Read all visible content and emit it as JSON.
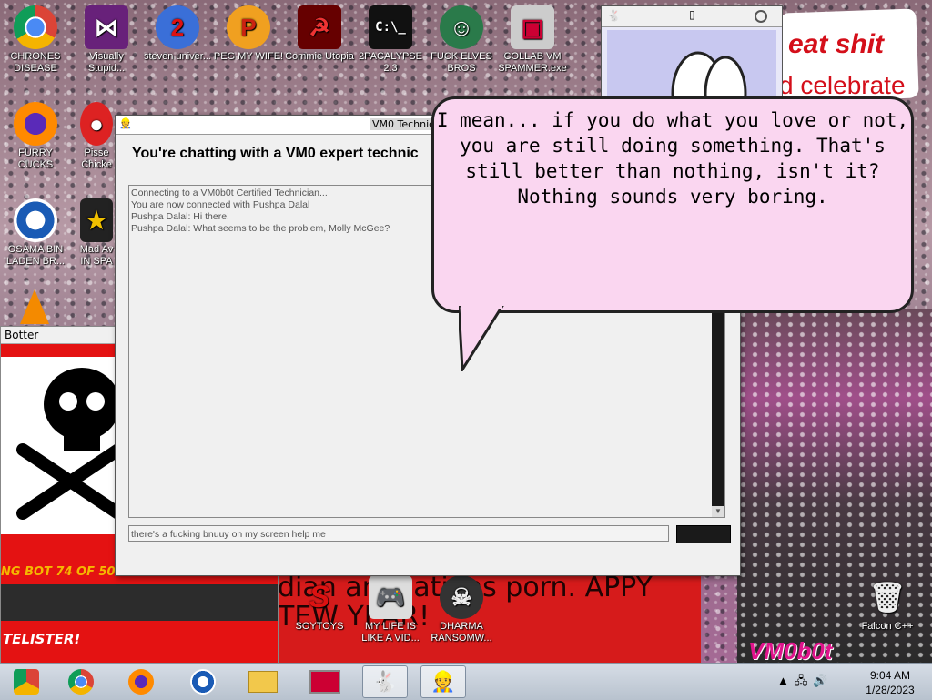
{
  "desktop": {
    "icons": [
      {
        "label": "CHRONES DISEASE",
        "icon": "chrome-icon"
      },
      {
        "label": "Visually Stupid...",
        "icon": "visual-studio-icon"
      },
      {
        "label": "steven univer...",
        "icon": "number-2-icon"
      },
      {
        "label": "PEG MY WIFE!",
        "icon": "p-icon"
      },
      {
        "label": "Commie Utopia",
        "icon": "hammer-sickle-icon"
      },
      {
        "label": "2PACALYPSE 2.3",
        "icon": "console-icon"
      },
      {
        "label": "FUCK ELVES BROS",
        "icon": "santa-icon"
      },
      {
        "label": "COLLAB VM SPAMMER.exe",
        "icon": "monitor-icon"
      },
      {
        "label": "FURRY CUCKS",
        "icon": "firefox-icon"
      },
      {
        "label": "Pisse Chicke",
        "icon": "angry-bird-icon"
      },
      {
        "label": "OSAMA BIN LADEN BR...",
        "icon": "obama-icon"
      },
      {
        "label": "Mad Av IN SPA",
        "icon": "angry-birds-space-icon"
      },
      {
        "label": "SOYTOYS",
        "icon": "soytoys-icon"
      },
      {
        "label": "MY LIFE IS LIKE A VID...",
        "icon": "gamepad-icon"
      },
      {
        "label": "DHARMA RANSOMW...",
        "icon": "skull-icon"
      },
      {
        "label": "Falcon C++",
        "icon": "recycle-bin-icon"
      }
    ],
    "wallpaper_text": {
      "sign_line1": "eat shit",
      "sign_line2": "d celebrate",
      "red_area": "dian animations porn. APPY TEW YEAR!",
      "logo": "VM0b0t"
    }
  },
  "botter_window": {
    "title": "Botter",
    "ticker": "NG BOT 74 OF 50",
    "footer": "TELISTER!"
  },
  "chat_window": {
    "title": "VM0 Technic",
    "heading": "You're chatting with a VM0 expert technic",
    "log": [
      "Connecting to a VM0b0t Certified Technician...",
      "You are now connected with Pushpa Dalal",
      "Pushpa Dalal: Hi there!",
      "Pushpa Dalal: What seems to be the problem, Molly McGee?"
    ],
    "input_value": "there's a fucking bnuuy on my screen help me "
  },
  "speech_bubble": {
    "lines": [
      "I mean... if you do what you love or not,",
      "you are still doing something. That's",
      "still better than nothing, isn't it?",
      "Nothing sounds very boring."
    ]
  },
  "taskbar": {
    "buttons": [
      {
        "name": "chrome-alt-taskbar-button",
        "icon": "chrome-alt-icon"
      },
      {
        "name": "chrome-taskbar-button",
        "icon": "chrome-icon"
      },
      {
        "name": "firefox-taskbar-button",
        "icon": "firefox-icon"
      },
      {
        "name": "obama-taskbar-button",
        "icon": "obama-icon"
      },
      {
        "name": "file-explorer-taskbar-button",
        "icon": "folder-icon"
      },
      {
        "name": "vm-spammer-taskbar-button",
        "icon": "monitor-icon"
      },
      {
        "name": "bunny-taskbar-button",
        "icon": "bunny-icon"
      },
      {
        "name": "technician-taskbar-button",
        "icon": "technician-icon"
      }
    ],
    "clock_time": "9:04 AM",
    "clock_date": "1/28/2023"
  }
}
